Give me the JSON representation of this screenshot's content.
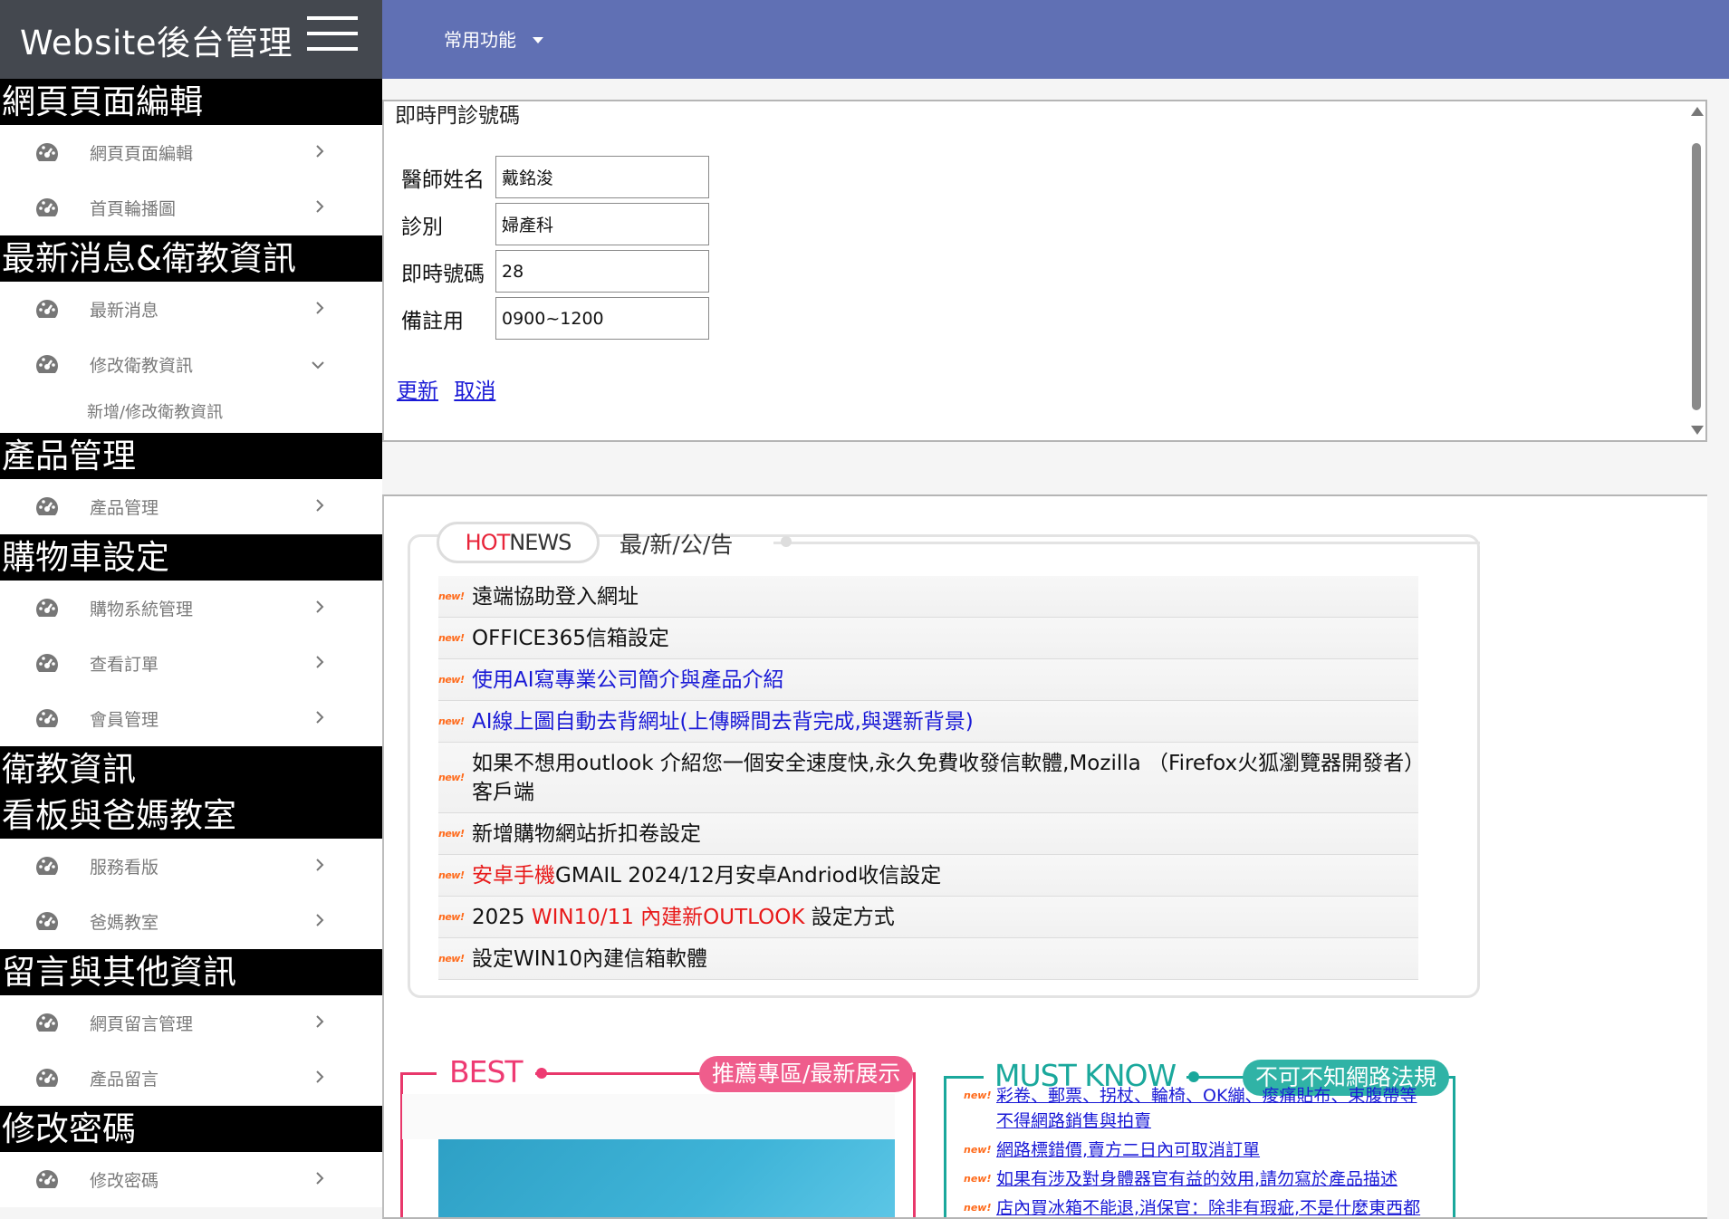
{
  "brand": {
    "title": "Website後台管理"
  },
  "topnav": {
    "menu_label": "常用功能"
  },
  "sidebar": {
    "sections": [
      {
        "title": "網頁頁面編輯",
        "items": [
          {
            "label": "網頁頁面編輯"
          },
          {
            "label": "首頁輪播圖"
          }
        ]
      },
      {
        "title": "最新消息&衛教資訊",
        "items": [
          {
            "label": "最新消息"
          },
          {
            "label": "修改衛教資訊"
          }
        ],
        "subitems": [
          {
            "label": "新增/修改衛教資訊"
          }
        ]
      },
      {
        "title": "產品管理",
        "items": [
          {
            "label": "產品管理"
          }
        ]
      },
      {
        "title": "購物車設定",
        "items": [
          {
            "label": "購物系統管理"
          },
          {
            "label": "查看訂單"
          },
          {
            "label": "會員管理"
          }
        ]
      },
      {
        "title_line1": "衛教資訊",
        "title_line2": "看板與爸媽教室",
        "items": [
          {
            "label": "服務看版"
          },
          {
            "label": "爸媽教室"
          }
        ]
      },
      {
        "title": "留言與其他資訊",
        "items": [
          {
            "label": "網頁留言管理"
          },
          {
            "label": "產品留言"
          }
        ]
      },
      {
        "title": "修改密碼",
        "items": [
          {
            "label": "修改密碼"
          }
        ]
      }
    ]
  },
  "form": {
    "title": "即時門診號碼",
    "fields": [
      {
        "label": "醫師姓名",
        "value": "戴銘浚"
      },
      {
        "label": "診別",
        "value": "婦產科"
      },
      {
        "label": "即時號碼",
        "value": "28"
      },
      {
        "label": "備註用",
        "value": "0900~1200"
      }
    ],
    "update_label": "更新",
    "cancel_label": "取消"
  },
  "hotnews": {
    "hot": "HOT",
    "news": "NEWS",
    "title_zh": "最/新/公/告",
    "badge": "new!",
    "items": [
      {
        "text": "遠端協助登入網址"
      },
      {
        "text": "OFFICE365信箱設定"
      },
      {
        "text": "使用AI寫專業公司簡介與產品介紹"
      },
      {
        "text": "AI線上圖自動去背網址(上傳瞬間去背完成,與選新背景)"
      },
      {
        "text": "如果不想用outlook 介紹您一個安全速度快,永久免費收發信軟體,Mozilla （Firefox火狐瀏覽器開發者）客戶端"
      },
      {
        "text": "新增購物網站折扣卷設定"
      },
      {
        "text_red": "安卓手機",
        "text": "GMAIL 2024/12月安卓Andriod收信設定"
      },
      {
        "text_pre": "2025 ",
        "text_red": "WIN10/11 內建新OUTLOOK",
        "text_post": " 設定方式"
      },
      {
        "text": "設定WIN10內建信箱軟體"
      }
    ]
  },
  "best": {
    "title": "BEST",
    "pill": "推薦專區/最新展示"
  },
  "mustknow": {
    "title": "MUST KNOW",
    "pill": "不可不知網路法規",
    "items": [
      {
        "text": "彩卷、郵票、拐杖、輪椅、OK繃、痠痛貼布、束腹帶等不得網路銷售與拍賣"
      },
      {
        "text": "網路標錯價,賣方二日內可取消訂單"
      },
      {
        "text": "如果有涉及對身體器官有益的效用,請勿寫於產品描述"
      },
      {
        "text": "店內買冰箱不能退,消保官：除非有瑕疵,不是什麼東西都可以退"
      }
    ]
  },
  "colors": {
    "topnav": "#6070b4",
    "brand_bg": "#44484f",
    "link": "#1a1ad6",
    "best": "#ee3a72",
    "mustknow": "#1aa89c",
    "hot": "#e8253a"
  }
}
